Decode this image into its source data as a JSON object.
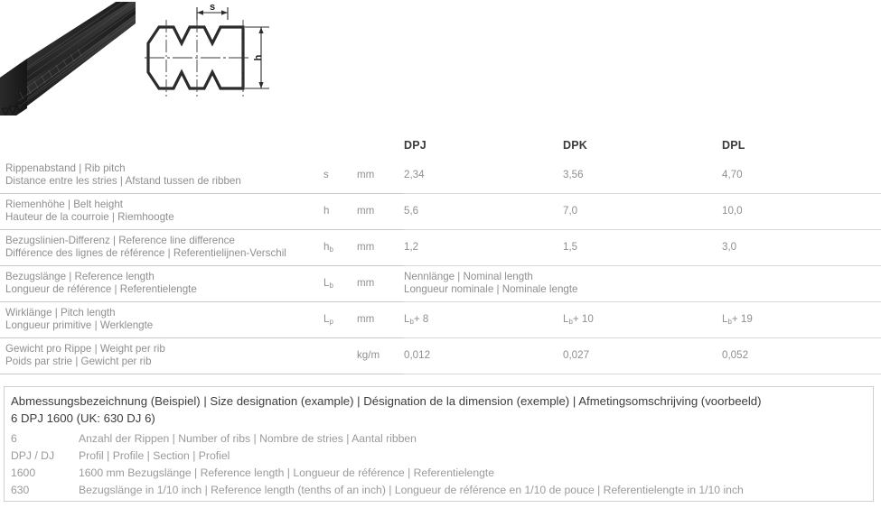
{
  "figure": {
    "photo_alt": "v-ribbed-belt-photo",
    "diagram": {
      "pitch_label": "s",
      "height_label": "h"
    }
  },
  "table": {
    "columns": [
      "",
      "",
      "",
      "DPJ",
      "DPK",
      "DPL"
    ],
    "headers": {
      "dpj": "DPJ",
      "dpk": "DPK",
      "dpl": "DPL"
    },
    "rows": [
      {
        "desc_line1": "Rippenabstand | Rib pitch",
        "desc_line2": "Distance entre les stries | Afstand tussen de ribben",
        "symbol": "s",
        "symbol_sub": "",
        "unit": "mm",
        "dpj": "2,34",
        "dpk": "3,56",
        "dpl": "4,70",
        "span": false
      },
      {
        "desc_line1": "Riemenhöhe | Belt height",
        "desc_line2": "Hauteur de la courroie | Riemhoogte",
        "symbol": "h",
        "symbol_sub": "",
        "unit": "mm",
        "dpj": "5,6",
        "dpk": "7,0",
        "dpl": "10,0",
        "span": false
      },
      {
        "desc_line1": "Bezugslinien-Differenz | Reference line difference",
        "desc_line2": "Différence des lignes de référence | Referentielijnen-Verschil",
        "symbol": "h",
        "symbol_sub": "b",
        "unit": "mm",
        "dpj": "1,2",
        "dpk": "1,5",
        "dpl": "3,0",
        "span": false
      },
      {
        "desc_line1": "Bezugslänge | Reference length",
        "desc_line2": "Longueur de référence | Referentielengte",
        "symbol": "L",
        "symbol_sub": "b",
        "unit": "mm",
        "span": true,
        "span_line1": "Nennlänge | Nominal length",
        "span_line2": "Longueur nominale | Nominale lengte",
        "dpj": "",
        "dpk": "",
        "dpl": ""
      },
      {
        "desc_line1": "Wirklänge | Pitch length",
        "desc_line2": "Longueur primitive | Werklengte",
        "symbol": "L",
        "symbol_sub": "p",
        "unit": "mm",
        "dpj_base": "L",
        "dpj_sub": "b",
        "dpj_add": "+ 8",
        "dpk_base": "L",
        "dpk_sub": "b",
        "dpk_add": "+ 10",
        "dpl_base": "L",
        "dpl_sub": "b",
        "dpl_add": "+ 19",
        "formula": true,
        "span": false
      },
      {
        "desc_line1": "Gewicht pro Rippe | Weight per rib",
        "desc_line2": "Poids par strie | Gewicht per rib",
        "symbol": "",
        "symbol_sub": "",
        "unit": "kg/m",
        "dpj": "0,012",
        "dpk": "0,027",
        "dpl": "0,052",
        "span": false
      }
    ]
  },
  "legend": {
    "title": "Abmessungsbezeichnung (Beispiel) | Size designation (example) | Désignation de la dimension (exemple) | Afmetingsomschrijving (voorbeeld)",
    "example": "6 DPJ 1600 (UK: 630 DJ 6)",
    "items": [
      {
        "key": "6",
        "desc": "Anzahl der Rippen  | Number of ribs | Nombre de stries | Aantal ribben"
      },
      {
        "key": "DPJ / DJ",
        "desc": "Profil | Profile | Section | Profiel"
      },
      {
        "key": "1600",
        "desc": "1600 mm Bezugslänge | Reference length | Longueur de référence | Referentielengte"
      },
      {
        "key": "630",
        "desc": "Bezugslänge in 1/10 inch | Reference length (tenths of an inch) | Longueur de référence en 1/10 de pouce | Referentielengte in 1/10 inch"
      }
    ]
  },
  "colors": {
    "body_text": "#8f8f8f",
    "header_text": "#3a3a3a",
    "rule": "#c9c9c9",
    "box_border": "#cfcfcf",
    "belt_dark": "#2f2f2f"
  }
}
